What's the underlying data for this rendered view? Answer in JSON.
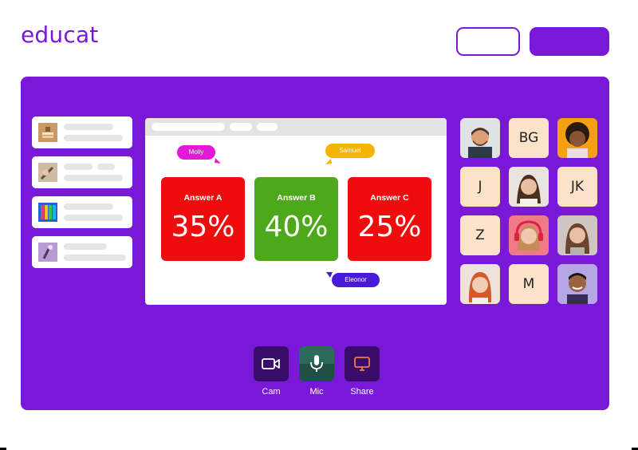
{
  "brand": {
    "logo_text": "educat",
    "accent": "#7a18d8"
  },
  "header": {
    "outline_button_label": "",
    "solid_button_label": ""
  },
  "quiz": {
    "answers": [
      {
        "label": "Answer A",
        "percent": "35%",
        "color": "#ee0c0c"
      },
      {
        "label": "Answer B",
        "percent": "40%",
        "color": "#4ea91a"
      },
      {
        "label": "Answer C",
        "percent": "25%",
        "color": "#ee0c0c"
      }
    ],
    "cursors": [
      {
        "name": "Molly",
        "color": "#e21ad7"
      },
      {
        "name": "Samuel",
        "color": "#f5b400"
      },
      {
        "name": "Eleonor",
        "color": "#4a1bd6"
      }
    ]
  },
  "participants": {
    "letters": [
      "BG",
      "J",
      "JK",
      "Z",
      "M"
    ]
  },
  "controls": [
    {
      "label": "Cam",
      "icon": "camera-icon"
    },
    {
      "label": "Mic",
      "icon": "microphone-icon"
    },
    {
      "label": "Share",
      "icon": "screen-share-icon"
    }
  ]
}
